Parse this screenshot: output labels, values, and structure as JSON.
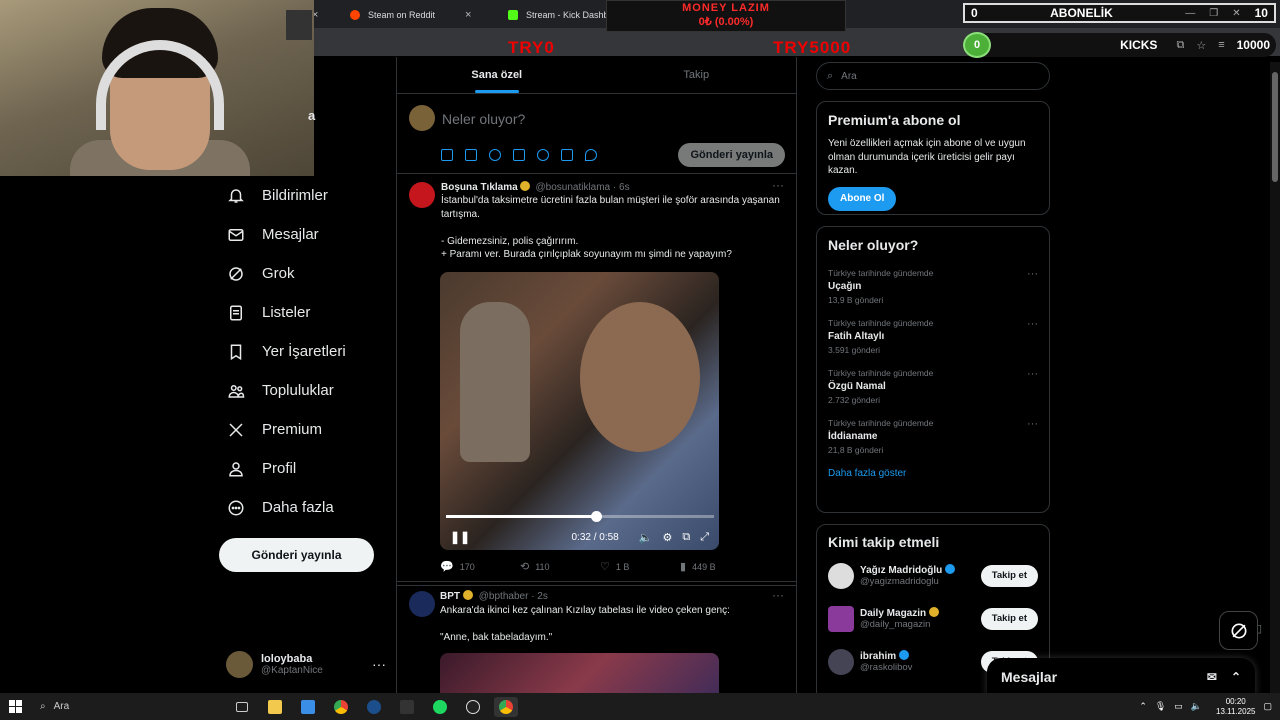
{
  "browser": {
    "tabs": [
      {
        "label": "Steam on Reddit"
      },
      {
        "label": "Stream - Kick Dashboard"
      }
    ]
  },
  "overlay": {
    "money_title": "MONEY LAZIM",
    "money_value": "0₺ (0.00%)",
    "try_left": "TRY0",
    "try_right": "TRY5000",
    "abone_left": "0",
    "abone_label": "ABONELİK",
    "abone_right": "10",
    "kicks_value": "0",
    "kicks_label": "KICKS",
    "kicks_right": "10000"
  },
  "sidebar": {
    "partial_label": "a",
    "items": [
      {
        "label": "Bildirimler",
        "icon": "bell-icon"
      },
      {
        "label": "Mesajlar",
        "icon": "mail-icon"
      },
      {
        "label": "Grok",
        "icon": "grok-icon"
      },
      {
        "label": "Listeler",
        "icon": "list-icon"
      },
      {
        "label": "Yer İşaretleri",
        "icon": "bookmark-icon"
      },
      {
        "label": "Topluluklar",
        "icon": "communities-icon"
      },
      {
        "label": "Premium",
        "icon": "x-logo-icon"
      },
      {
        "label": "Profil",
        "icon": "person-icon"
      },
      {
        "label": "Daha fazla",
        "icon": "more-circle-icon"
      }
    ],
    "post_button": "Gönderi yayınla",
    "user": {
      "name": "loloybaba",
      "handle": "@KaptanNice"
    }
  },
  "timeline": {
    "tabs": [
      {
        "label": "Sana özel"
      },
      {
        "label": "Takip"
      }
    ],
    "compose_placeholder": "Neler oluyor?",
    "compose_button": "Gönderi yayınla",
    "posts": [
      {
        "name": "Boşuna Tıklama",
        "handle": "@bosunatiklama",
        "time": "· 6s",
        "text": "İstanbul'da taksimetre ücretini fazla bulan müşteri ile şoför arasında yaşanan tartışma.\n\n- Gidemezsiniz, polis çağırırım.\n+ Paramı ver. Burada çırılçıplak soyunayım mı şimdi ne yapayım?",
        "video_time": "0:32 / 0:58",
        "progress": 0.56,
        "replies": "170",
        "reposts": "110",
        "likes": "1 B",
        "views": "449 B"
      },
      {
        "name": "BPT",
        "handle": "@bpthaber",
        "time": "· 2s",
        "text": "Ankara'da ikinci kez çalınan Kızılay tabelası ile video çeken genç:\n\n\"Anne, bak tabeladayım.\""
      }
    ]
  },
  "right": {
    "search_placeholder": "Ara",
    "premium": {
      "title": "Premium'a abone ol",
      "text": "Yeni özellikleri açmak için abone ol ve uygun olman durumunda içerik üreticisi gelir payı kazan.",
      "button": "Abone Ol"
    },
    "trends": {
      "title": "Neler oluyor?",
      "items": [
        {
          "context": "Türkiye tarihinde gündemde",
          "name": "Uçağın",
          "count": "13,9 B gönderi"
        },
        {
          "context": "Türkiye tarihinde gündemde",
          "name": "Fatih Altaylı",
          "count": "3.591 gönderi"
        },
        {
          "context": "Türkiye tarihinde gündemde",
          "name": "Özgü Namal",
          "count": "2.732 gönderi"
        },
        {
          "context": "Türkiye tarihinde gündemde",
          "name": "İddianame",
          "count": "21,8 B gönderi"
        }
      ],
      "more": "Daha fazla göster"
    },
    "who_to_follow": {
      "title": "Kimi takip etmeli",
      "items": [
        {
          "name": "Yağız Madridoğlu",
          "handle": "@yagizmadridoglu",
          "button": "Takip et"
        },
        {
          "name": "Daily Magazin",
          "handle": "@daily_magazin",
          "button": "Takip et"
        },
        {
          "name": "ibrahim",
          "handle": "@raskolibov",
          "button": "Takip et"
        }
      ]
    }
  },
  "messages_drawer": {
    "title": "Mesajlar"
  },
  "taskbar": {
    "search": "Ara",
    "time": "00:20",
    "date": "13.11.2025"
  },
  "colors": {
    "accent": "#1d9bf0",
    "background": "#000000",
    "overlay_red": "#ff2a2a",
    "kick_green": "#4caf37"
  }
}
